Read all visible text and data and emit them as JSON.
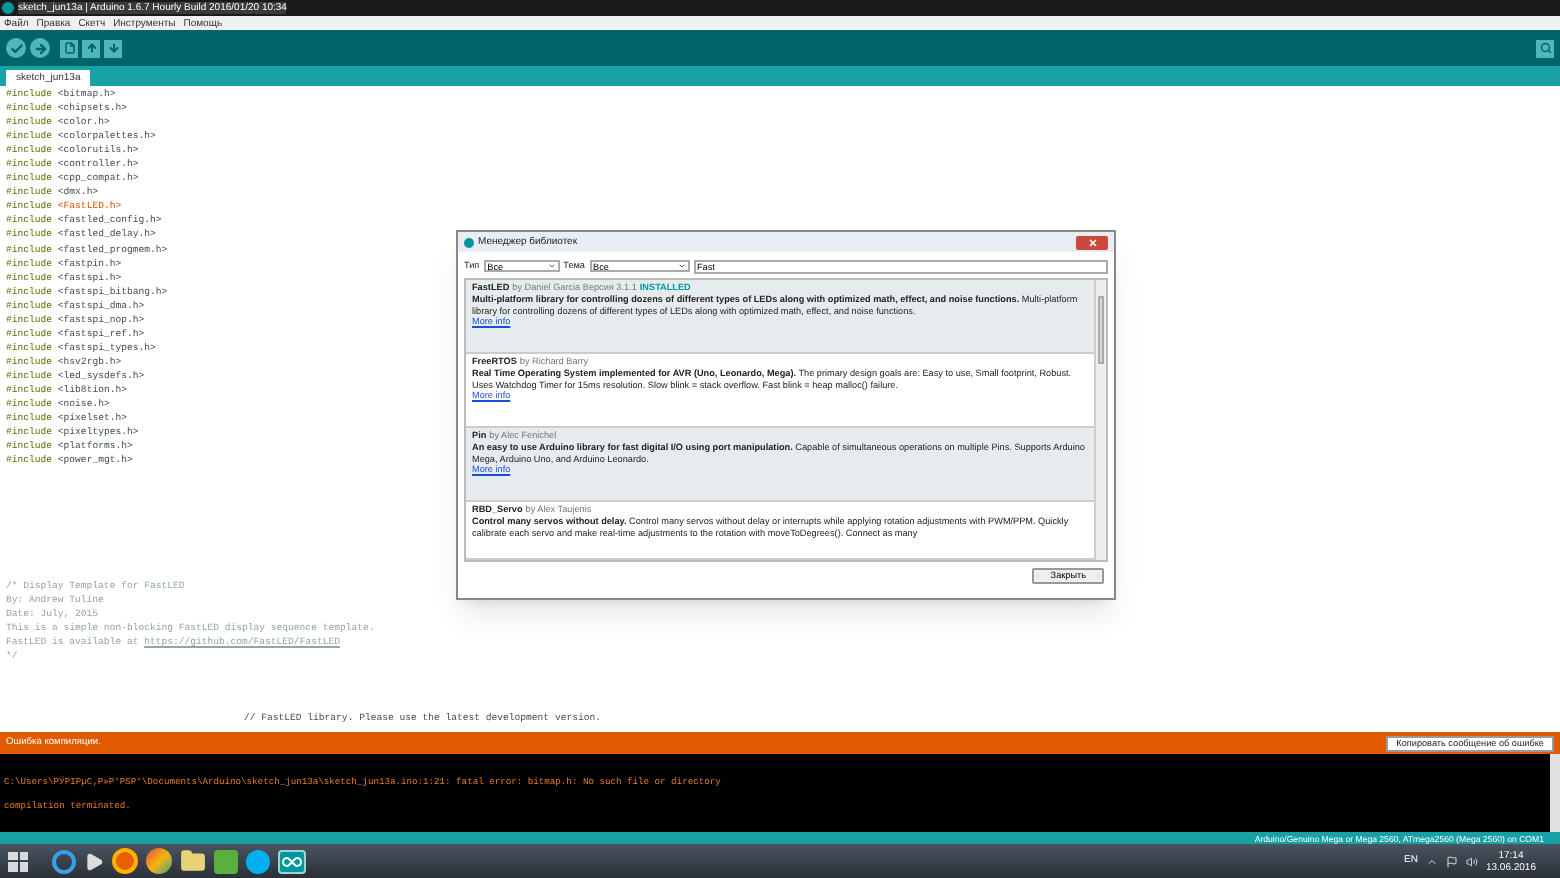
{
  "window": {
    "title": "sketch_jun13a | Arduino 1.6.7 Hourly Build 2016/01/20 10:34"
  },
  "menu": [
    "Файл",
    "Правка",
    "Скетч",
    "Инструменты",
    "Помощь"
  ],
  "tabs": [
    {
      "label": "sketch_jun13a",
      "selected": true
    }
  ],
  "editor": {
    "includes": [
      {
        "keyword": "#include",
        "file": "<bitmap.h>",
        "highlight": false
      },
      {
        "keyword": "#include",
        "file": "<chipsets.h>",
        "highlight": false
      },
      {
        "keyword": "#include",
        "file": "<color.h>",
        "highlight": false
      },
      {
        "keyword": "#include",
        "file": "<colorpalettes.h>",
        "highlight": false
      },
      {
        "keyword": "#include",
        "file": "<colorutils.h>",
        "highlight": false
      },
      {
        "keyword": "#include",
        "file": "<controller.h>",
        "highlight": false
      },
      {
        "keyword": "#include",
        "file": "<cpp_compat.h>",
        "highlight": false
      },
      {
        "keyword": "#include",
        "file": "<dmx.h>",
        "highlight": false
      },
      {
        "keyword": "#include",
        "file": "<FastLED.h>",
        "highlight": true
      },
      {
        "keyword": "#include",
        "file": "<fastled_config.h>",
        "highlight": false
      },
      {
        "keyword": "#include",
        "file": "<fastled_delay.h>",
        "highlight": false
      },
      {
        "keyword": "#include",
        "file": "<fastled_progmem.h>",
        "highlight": false
      },
      {
        "keyword": "#include",
        "file": "<fastpin.h>",
        "highlight": false
      },
      {
        "keyword": "#include",
        "file": "<fastspi.h>",
        "highlight": false
      },
      {
        "keyword": "#include",
        "file": "<fastspi_bitbang.h>",
        "highlight": false
      },
      {
        "keyword": "#include",
        "file": "<fastspi_dma.h>",
        "highlight": false
      },
      {
        "keyword": "#include",
        "file": "<fastspi_nop.h>",
        "highlight": false
      },
      {
        "keyword": "#include",
        "file": "<fastspi_ref.h>",
        "highlight": false
      },
      {
        "keyword": "#include",
        "file": "<fastspi_types.h>",
        "highlight": false
      },
      {
        "keyword": "#include",
        "file": "<hsv2rgb.h>",
        "highlight": false
      },
      {
        "keyword": "#include",
        "file": "<led_sysdefs.h>",
        "highlight": false
      },
      {
        "keyword": "#include",
        "file": "<lib8tion.h>",
        "highlight": false
      },
      {
        "keyword": "#include",
        "file": "<noise.h>",
        "highlight": false
      },
      {
        "keyword": "#include",
        "file": "<pixelset.h>",
        "highlight": false
      },
      {
        "keyword": "#include",
        "file": "<pixeltypes.h>",
        "highlight": false
      },
      {
        "keyword": "#include",
        "file": "<platforms.h>",
        "highlight": false
      },
      {
        "keyword": "#include",
        "file": "<power_mgt.h>",
        "highlight": false
      }
    ],
    "comment": [
      {
        "text": "/* Display Template for FastLED"
      },
      {
        "text": "By: Andrew Tuline"
      },
      {
        "text": "Date: July, 2015"
      },
      {
        "text": "This is a simple non-blocking FastLED display sequence template."
      },
      {
        "text": "FastLED is available at ",
        "link": "https://github.com/FastLED/FastLED"
      },
      {
        "text": "*/"
      }
    ],
    "line_comment": "// FastLED library. Please use the latest development version."
  },
  "dialog": {
    "title": "Менеджер библиотек",
    "type_label": "Тип",
    "type_value": "Все",
    "topic_label": "Тема",
    "topic_value": "Все",
    "search_value": "Fast",
    "libraries": [
      {
        "name": "FastLED",
        "author": "by Daniel Garcia Версия 3.1.1",
        "status": "INSTALLED",
        "summary": "Multi-platform library for controlling dozens of different types of LEDs along with optimized math, effect, and noise functions.",
        "description": "Multi-platform library for controlling dozens of different types of LEDs along with optimized math, effect, and noise functions.",
        "more": "More info"
      },
      {
        "name": "FreeRTOS",
        "author": "by Richard Barry",
        "summary": "Real Time Operating System implemented for AVR (Uno, Leonardo, Mega).",
        "description": "The primary design goals are: Easy to use, Small footprint, Robust. Uses Watchdog Timer for 15ms resolution. Slow blink = stack overflow. Fast blink = heap malloc() failure.",
        "more": "More info"
      },
      {
        "name": "Pin",
        "author": "by Alec Fenichel",
        "summary": "An easy to use Arduino library for fast digital I/O using port manipulation.",
        "description": "Capable of simultaneous operations on multiple Pins. Supports Arduino Mega, Arduino Uno, and Arduino Leonardo.",
        "more": "More info"
      },
      {
        "name": "RBD_Servo",
        "author": "by Alex Taujenis",
        "summary": "Control many servos without delay.",
        "description": "Control many servos without delay or interrupts while applying rotation adjustments with PWM/PPM. Quickly calibrate each servo and make real-time adjustments to the rotation with moveToDegrees(). Connect as many"
      }
    ],
    "close_button": "Закрыть"
  },
  "error_bar": {
    "message": "Ошибка компиляции.",
    "copy_button": "Копировать сообщение об ошибке"
  },
  "console": [
    "C:\\Users\\РЎРІРµС‚Р»Р°РЅР°\\Documents\\Arduino\\sketch_jun13a\\sketch_jun13a.ino:1:21: fatal error: bitmap.h: No such file or directory",
    "compilation terminated."
  ],
  "status_bar": "Arduino/Genuino Mega or Mega 2560, ATmega2560 (Mega 2560) on COM1",
  "taskbar": {
    "language": "EN",
    "time": "17:14",
    "date": "13.06.2016"
  }
}
